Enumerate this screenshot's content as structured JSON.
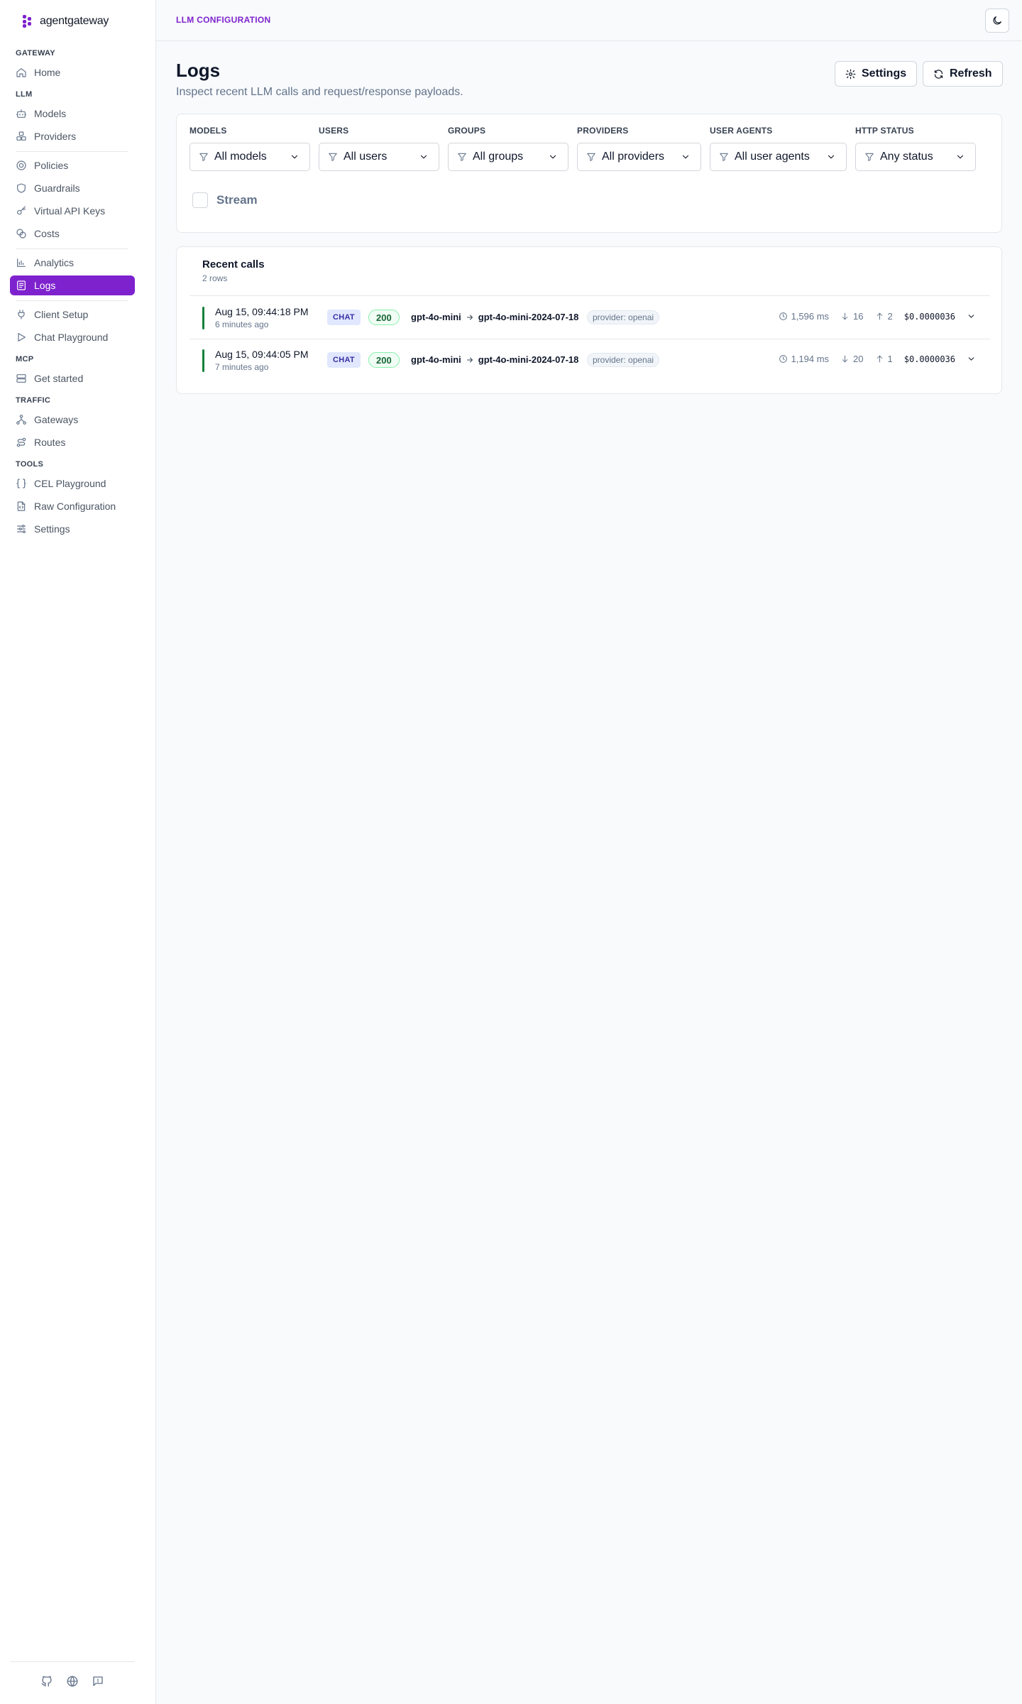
{
  "brand": {
    "name": "agentgateway"
  },
  "sidebar": {
    "sections": [
      {
        "label": "GATEWAY"
      },
      {
        "label": "LLM"
      },
      {
        "label": "MCP"
      },
      {
        "label": "TRAFFIC"
      },
      {
        "label": "TOOLS"
      }
    ],
    "items": [
      {
        "label": "Home",
        "icon": "home-icon"
      },
      {
        "label": "Models",
        "icon": "robot-icon"
      },
      {
        "label": "Providers",
        "icon": "boxes-icon"
      },
      {
        "label": "Policies",
        "icon": "policy-icon"
      },
      {
        "label": "Guardrails",
        "icon": "shield-icon"
      },
      {
        "label": "Virtual API Keys",
        "icon": "key-icon"
      },
      {
        "label": "Costs",
        "icon": "coins-icon"
      },
      {
        "label": "Analytics",
        "icon": "chart-icon"
      },
      {
        "label": "Logs",
        "icon": "logs-icon",
        "active": true
      },
      {
        "label": "Client Setup",
        "icon": "plug-icon"
      },
      {
        "label": "Chat Playground",
        "icon": "play-icon"
      },
      {
        "label": "Get started",
        "icon": "server-icon"
      },
      {
        "label": "Gateways",
        "icon": "network-icon"
      },
      {
        "label": "Routes",
        "icon": "route-icon"
      },
      {
        "label": "CEL Playground",
        "icon": "braces-icon"
      },
      {
        "label": "Raw Configuration",
        "icon": "file-code-icon"
      },
      {
        "label": "Settings",
        "icon": "sliders-icon"
      }
    ],
    "footer_icons": [
      "github-icon",
      "globe-icon",
      "feedback-icon"
    ]
  },
  "topbar": {
    "breadcrumb": "LLM CONFIGURATION",
    "theme_icon": "moon-icon"
  },
  "page": {
    "title": "Logs",
    "subtitle": "Inspect recent LLM calls and request/response payloads.",
    "settings_label": "Settings",
    "refresh_label": "Refresh"
  },
  "filters": [
    {
      "label": "MODELS",
      "value": "All models"
    },
    {
      "label": "USERS",
      "value": "All users"
    },
    {
      "label": "GROUPS",
      "value": "All groups"
    },
    {
      "label": "PROVIDERS",
      "value": "All providers"
    },
    {
      "label": "USER AGENTS",
      "value": "All user agents"
    },
    {
      "label": "HTTP STATUS",
      "value": "Any status"
    }
  ],
  "stream": {
    "label": "Stream",
    "checked": false
  },
  "recent": {
    "title": "Recent calls",
    "count": "2 rows",
    "rows": [
      {
        "time": "Aug 15, 09:44:18 PM",
        "ago": "6 minutes ago",
        "kind": "CHAT",
        "status": "200",
        "model": "gpt-4o-mini",
        "resolved_model": "gpt-4o-mini-2024-07-18",
        "provider": "provider: openai",
        "latency": "1,596 ms",
        "tokens_in": "16",
        "tokens_out": "2",
        "cost": "$0.0000036"
      },
      {
        "time": "Aug 15, 09:44:05 PM",
        "ago": "7 minutes ago",
        "kind": "CHAT",
        "status": "200",
        "model": "gpt-4o-mini",
        "resolved_model": "gpt-4o-mini-2024-07-18",
        "provider": "provider: openai",
        "latency": "1,194 ms",
        "tokens_in": "20",
        "tokens_out": "1",
        "cost": "$0.0000036"
      }
    ]
  },
  "colors": {
    "accent": "#7e22ce",
    "success": "#15803d"
  }
}
